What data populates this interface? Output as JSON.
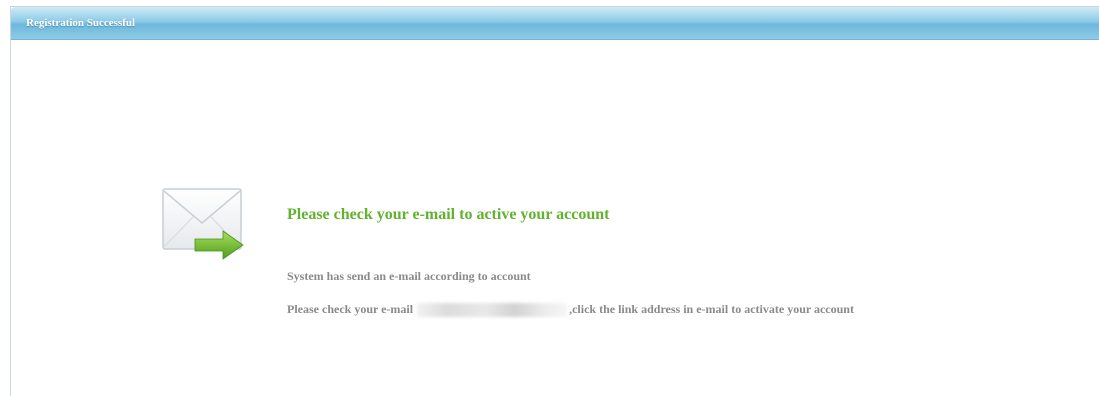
{
  "window": {
    "title": "Registration Successful"
  },
  "main": {
    "heading": "Please check your e-mail to active your account",
    "line1": "System has send an e-mail according to account",
    "line2_prefix": "Please check your e-mail",
    "line2_suffix": ",click the link address in e-mail to activate your account"
  },
  "icons": {
    "mail": "envelope-with-arrow-icon"
  },
  "colors": {
    "heading": "#62b22f",
    "body_text": "#8a8a8a",
    "titlebar": "#8ccbe8",
    "arrow": "#6cbf2a"
  }
}
